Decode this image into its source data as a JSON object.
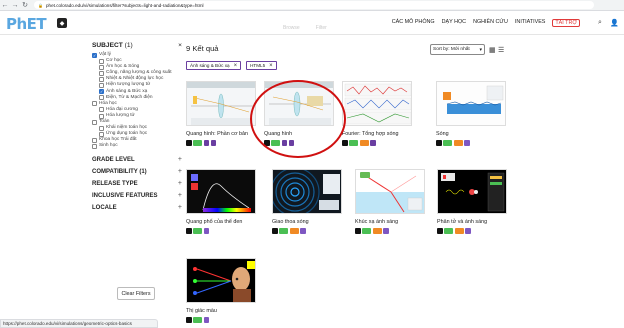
{
  "browser": {
    "url": "phet.colorado.edu/vi/simulations/filter?subjects=light-and-radiation&type=html"
  },
  "header": {
    "nav": [
      {
        "label": "CÁC MÔ PHỎNG"
      },
      {
        "label": "DẠY HỌC"
      },
      {
        "label": "NGHIÊN CỨU"
      },
      {
        "label": "INITIATIVES"
      }
    ],
    "donate": "TÀI TRỢ",
    "faded_tabs": [
      "Browse",
      "Filter"
    ]
  },
  "sidebar": {
    "subject_title": "SUBJECT",
    "subject_count": "(1)",
    "close_icon": "×",
    "tree": [
      {
        "label": "Vật lý",
        "level": 1,
        "checked": true
      },
      {
        "label": "Cơ học",
        "level": 2,
        "checked": false
      },
      {
        "label": "Âm học & Sóng",
        "level": 2,
        "checked": false
      },
      {
        "label": "Công, năng lượng & công suất",
        "level": 2,
        "checked": false
      },
      {
        "label": "Nhiệt & Nhiệt động lực học",
        "level": 2,
        "checked": false
      },
      {
        "label": "Hiện tượng lượng tử",
        "level": 2,
        "checked": false
      },
      {
        "label": "Ánh sáng & Bức xạ",
        "level": 2,
        "checked": true
      },
      {
        "label": "Điện, Từ & Mạch điện",
        "level": 2,
        "checked": false
      },
      {
        "label": "Hóa học",
        "level": 1,
        "checked": false
      },
      {
        "label": "Hóa đại cương",
        "level": 2,
        "checked": false
      },
      {
        "label": "Hóa lượng tử",
        "level": 2,
        "checked": false
      },
      {
        "label": "Toán",
        "level": 1,
        "checked": false
      },
      {
        "label": "Khái niệm toán học",
        "level": 2,
        "checked": false
      },
      {
        "label": "Ứng dụng toán học",
        "level": 2,
        "checked": false
      },
      {
        "label": "Khoa học Trái đất",
        "level": 1,
        "checked": false
      },
      {
        "label": "Sinh học",
        "level": 1,
        "checked": false
      }
    ],
    "sections": [
      {
        "label": "GRADE LEVEL"
      },
      {
        "label": "COMPATIBILITY (1)"
      },
      {
        "label": "RELEASE TYPE"
      },
      {
        "label": "INCLUSIVE FEATURES"
      },
      {
        "label": "LOCALE"
      }
    ],
    "clear_filters": "Clear Filters"
  },
  "results": {
    "count_label": "9 Kết quả",
    "sort_label": "Sort by: Mới nhất",
    "chips": [
      {
        "label": "Ánh sáng & Bức xạ"
      },
      {
        "label": "HTML5"
      }
    ],
    "cards": [
      {
        "title": "Quang hình: Phần cơ bản"
      },
      {
        "title": "Quang hình"
      },
      {
        "title": "Fourier: Tổng hợp sóng"
      },
      {
        "title": "Sóng"
      },
      {
        "title": "Quang phổ của thể đen"
      },
      {
        "title": "Giao thoa sóng"
      },
      {
        "title": "Khúc xạ ánh sáng"
      },
      {
        "title": "Phân tử và ánh sáng"
      },
      {
        "title": "Thị giác màu"
      }
    ]
  },
  "status_bar": {
    "url": "https://phet.colorado.edu/vi/simulations/geometric-optics-basics"
  },
  "colors": {
    "accent": "#2a6fc9",
    "chip_border": "#6b3fa0",
    "highlight_circle": "#d01010",
    "donate": "#e03a3a"
  }
}
